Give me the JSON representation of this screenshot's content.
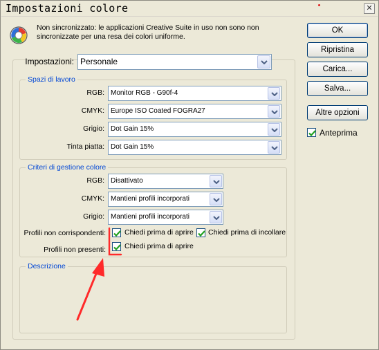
{
  "window": {
    "title": "Impostazioni colore"
  },
  "info": {
    "icon": "color-wheel-icon",
    "text": "Non sincronizzato: le applicazioni Creative Suite in uso non sono non sincronizzate per una resa dei colori uniforme."
  },
  "settings": {
    "label": "Impostazioni:",
    "value": "Personale"
  },
  "workspaces": {
    "legend": "Spazi di lavoro",
    "rgb": {
      "label": "RGB:",
      "value": "Monitor RGB - G90f-4"
    },
    "cmyk": {
      "label": "CMYK:",
      "value": "Europe ISO Coated FOGRA27"
    },
    "gray": {
      "label": "Grigio:",
      "value": "Dot Gain 15%"
    },
    "spot": {
      "label": "Tinta piatta:",
      "value": "Dot Gain 15%"
    }
  },
  "policies": {
    "legend": "Criteri di gestione colore",
    "rgb": {
      "label": "RGB:",
      "value": "Disattivato"
    },
    "cmyk": {
      "label": "CMYK:",
      "value": "Mantieni profili incorporati"
    },
    "gray": {
      "label": "Grigio:",
      "value": "Mantieni profili incorporati"
    },
    "mismatch": {
      "label": "Profili non corrispondenti:",
      "ask_open": {
        "label": "Chiedi prima di aprire",
        "checked": true
      },
      "ask_paste": {
        "label": "Chiedi prima di incollare",
        "checked": true
      }
    },
    "missing": {
      "label": "Profili non presenti:",
      "ask_open": {
        "label": "Chiedi prima di aprire",
        "checked": true
      }
    }
  },
  "description": {
    "legend": "Descrizione",
    "text": ""
  },
  "buttons": {
    "ok": "OK",
    "reset": "Ripristina",
    "load": "Carica...",
    "save": "Salva...",
    "more": "Altre opzioni"
  },
  "preview": {
    "label": "Anteprima",
    "checked": true
  },
  "colors": {
    "accent": "#0046d5",
    "check": "#21a121",
    "annotation": "#ff2a2a"
  }
}
